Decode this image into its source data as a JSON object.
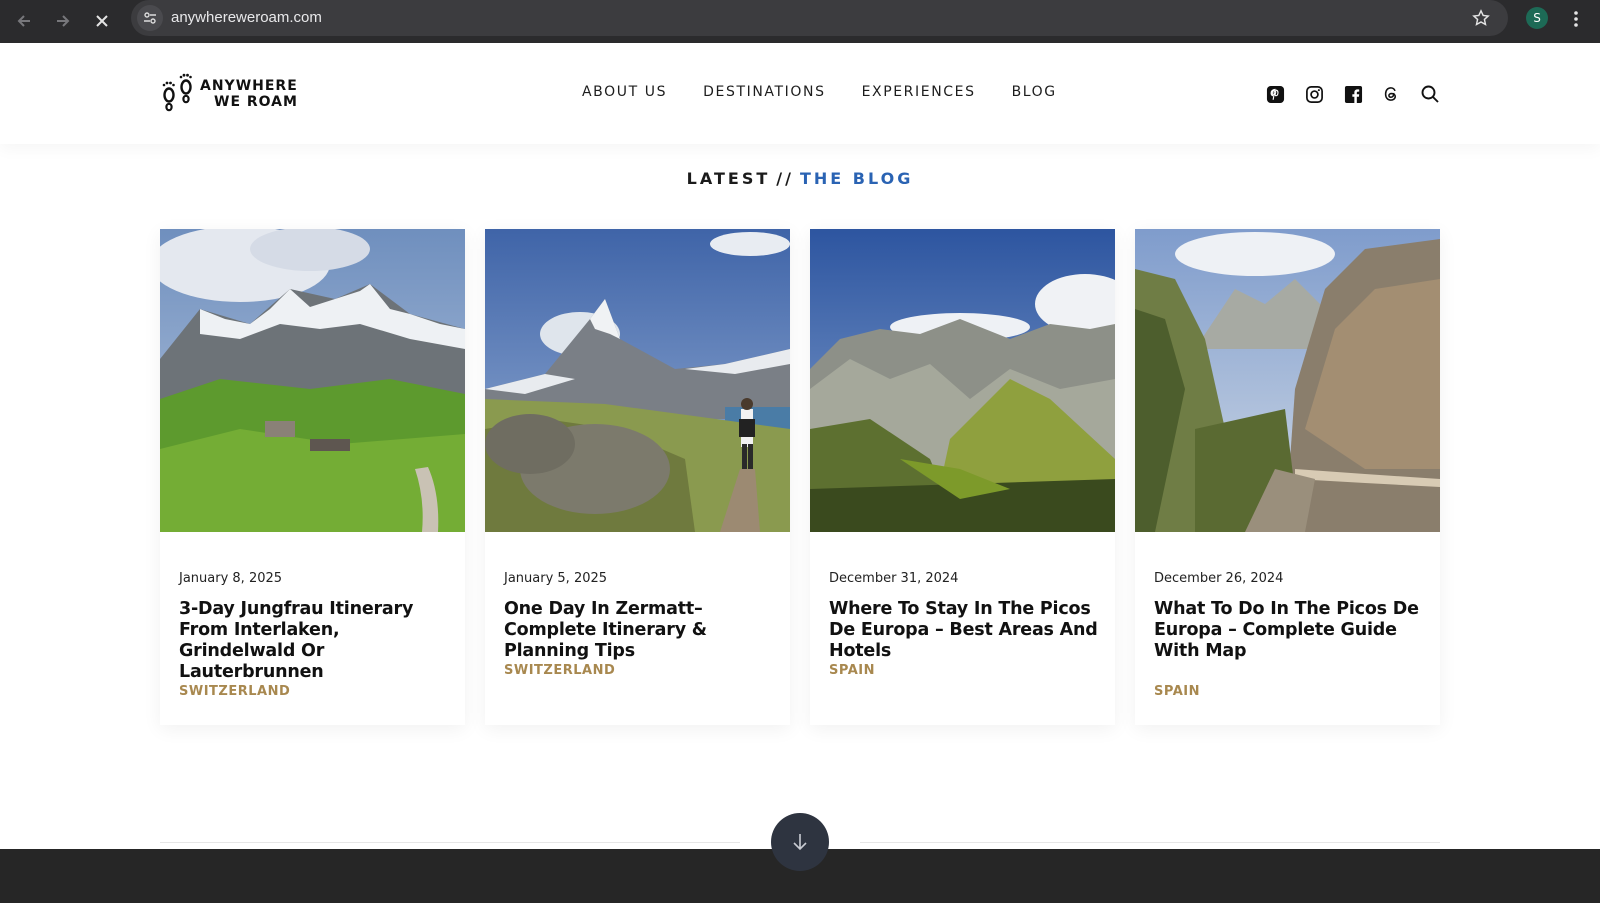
{
  "browser": {
    "url": "anywhereweroam.com",
    "profile_initial": "S"
  },
  "header": {
    "logo_line1": "ANYWHERE",
    "logo_line2": "WE ROAM",
    "nav": [
      "ABOUT US",
      "DESTINATIONS",
      "EXPERIENCES",
      "BLOG"
    ],
    "social_icons": [
      "pinterest-icon",
      "instagram-icon",
      "facebook-icon",
      "threads-icon",
      "search-icon"
    ]
  },
  "section": {
    "prefix": "LATEST",
    "separator": "//",
    "highlight": "THE BLOG",
    "highlight_color": "#2a63b3"
  },
  "posts": [
    {
      "date": "January 8, 2025",
      "title": "3-Day Jungfrau Itinerary From Interlaken, Grindelwald Or Lauterbrunnen",
      "category": "SWITZERLAND"
    },
    {
      "date": "January 5, 2025",
      "title": "One Day In Zermatt– Complete Itinerary & Planning Tips",
      "category": "SWITZERLAND"
    },
    {
      "date": "December 31, 2024",
      "title": "Where To Stay In The Picos De Europa – Best Areas And Hotels",
      "category": "SPAIN"
    },
    {
      "date": "December 26, 2024",
      "title": "What To Do In The Picos De Europa – Complete Guide With Map",
      "category": "SPAIN"
    }
  ],
  "colors": {
    "category": "#a8884f",
    "footer": "#262626"
  }
}
